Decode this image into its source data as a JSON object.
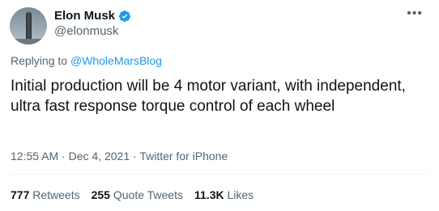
{
  "author": {
    "display_name": "Elon Musk",
    "handle": "@elonmusk",
    "verified": true
  },
  "more_icon": "more-horizontal-icon",
  "reply_context": {
    "prefix": "Replying to",
    "mention": "@WholeMarsBlog"
  },
  "tweet_text": "Initial production will be 4 motor variant, with independent, ultra fast response torque control of each wheel",
  "meta": {
    "time": "12:55 AM",
    "separator": "·",
    "date": "Dec 4, 2021",
    "source": "Twitter for iPhone"
  },
  "stats": {
    "retweets_count": "777",
    "retweets_label": "Retweets",
    "quotes_count": "255",
    "quotes_label": "Quote Tweets",
    "likes_count": "11.3K",
    "likes_label": "Likes"
  },
  "colors": {
    "text_primary": "#0f1419",
    "text_secondary": "#536471",
    "accent": "#1d9bf0",
    "divider": "#eff3f4"
  }
}
